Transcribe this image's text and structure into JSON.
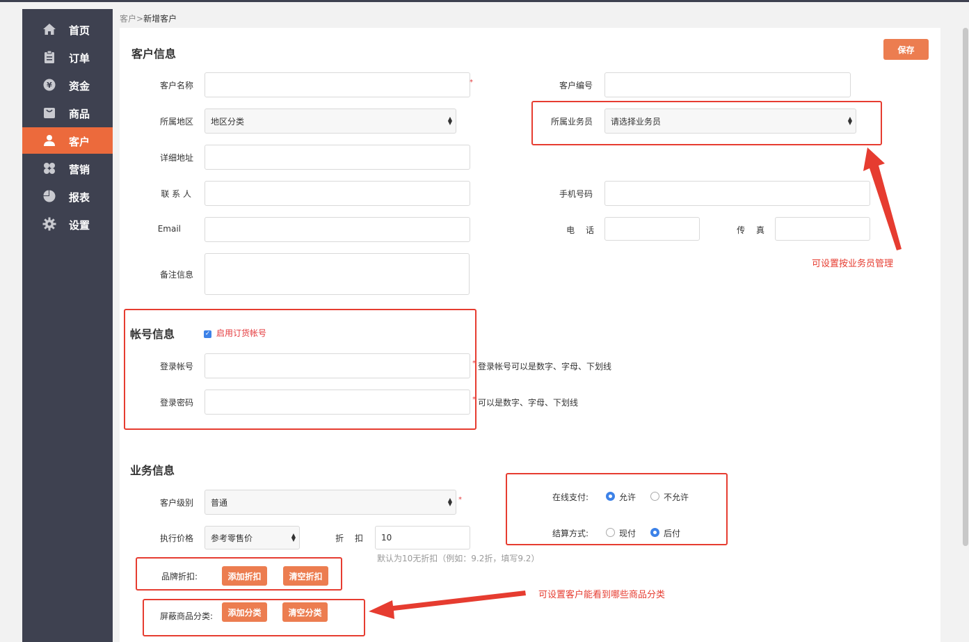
{
  "sidebar": {
    "items": [
      {
        "label": "首页",
        "icon": "home-icon"
      },
      {
        "label": "订单",
        "icon": "clipboard-icon"
      },
      {
        "label": "资金",
        "icon": "yen-coin-icon"
      },
      {
        "label": "商品",
        "icon": "bag-icon"
      },
      {
        "label": "客户",
        "icon": "user-icon",
        "active": true
      },
      {
        "label": "营销",
        "icon": "clover-icon"
      },
      {
        "label": "报表",
        "icon": "pie-chart-icon"
      },
      {
        "label": "设置",
        "icon": "gear-icon"
      }
    ]
  },
  "breadcrumb": {
    "parent": "客户",
    "sep": ">",
    "current": "新增客户"
  },
  "customer_info": {
    "title": "客户信息",
    "save_label": "保存",
    "name_label": "客户名称",
    "code_label": "客户编号",
    "region_label": "所属地区",
    "region_value": "地区分类",
    "salesman_label": "所属业务员",
    "salesman_value": "请选择业务员",
    "address_label": "详细地址",
    "contact_label": "联 系 人",
    "mobile_label": "手机号码",
    "email_label": "Email",
    "phone_label": "电　 话",
    "fax_label": "传　 真",
    "remark_label": "备注信息"
  },
  "account_info": {
    "title": "帐号信息",
    "enable_label": "启用订货帐号",
    "enable_checked": true,
    "login_label": "登录帐号",
    "login_hint": "登录帐号可以是数字、字母、下划线",
    "password_label": "登录密码",
    "password_hint": "可以是数字、字母、下划线"
  },
  "business_info": {
    "title": "业务信息",
    "level_label": "客户级别",
    "level_value": "普通",
    "price_label": "执行价格",
    "price_value": "参考零售价",
    "discount_label": "折　 扣",
    "discount_value": "10",
    "discount_hint": "默认为10无折扣（例如：9.2折，填写9.2）",
    "online_pay_label": "在线支付:",
    "online_pay_options": [
      "允许",
      "不允许"
    ],
    "online_pay_selected": "允许",
    "settle_label": "结算方式:",
    "settle_options": [
      "现付",
      "后付"
    ],
    "settle_selected": "后付",
    "brand_discount_label": "品牌折扣:",
    "add_discount_label": "添加折扣",
    "clear_discount_label": "清空折扣",
    "hide_category_label": "屏蔽商品分类:",
    "add_category_label": "添加分类",
    "clear_category_label": "清空分类"
  },
  "annotations": {
    "salesman_note": "可设置按业务员管理",
    "category_note": "可设置客户能看到哪些商品分类"
  },
  "colors": {
    "sidebar_bg": "#3e4150",
    "accent": "#ec6a3c",
    "annotation_red": "#e63c30",
    "checkbox_blue": "#3d82e8"
  }
}
